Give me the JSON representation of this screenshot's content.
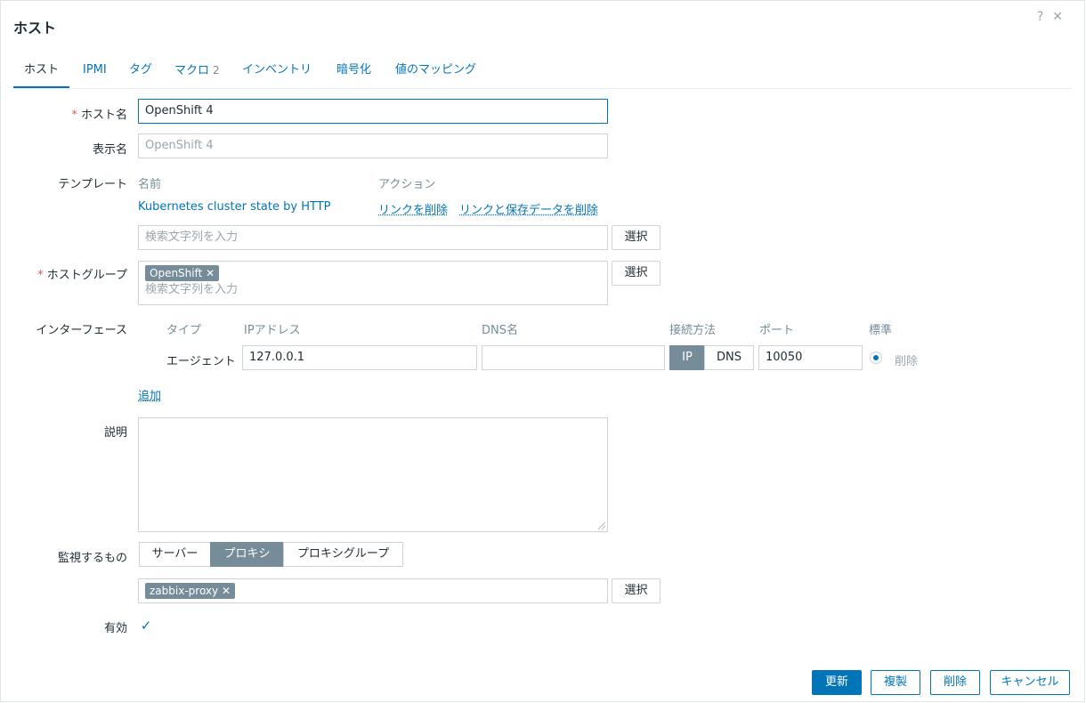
{
  "dialog": {
    "title": "ホスト",
    "help_icon": "?",
    "close_icon": "✕"
  },
  "tabs": [
    {
      "label": "ホスト"
    },
    {
      "label": "IPMI"
    },
    {
      "label": "タグ"
    },
    {
      "label": "マクロ",
      "count": "2"
    },
    {
      "label": "インベントリ"
    },
    {
      "label": "暗号化"
    },
    {
      "label": "値のマッピング"
    }
  ],
  "form": {
    "hostname": {
      "label": "ホスト名",
      "required_mark": "*",
      "value": "OpenShift 4"
    },
    "visible_name": {
      "label": "表示名",
      "placeholder": "OpenShift 4"
    },
    "templates": {
      "label": "テンプレート",
      "col_name": "名前",
      "col_action": "アクション",
      "linked": [
        {
          "name": "Kubernetes cluster state by HTTP",
          "unlink": "リンクを削除",
          "unlink_clear": "リンクと保存データを削除"
        }
      ],
      "search_placeholder": "検索文字列を入力",
      "select_button": "選択"
    },
    "host_groups": {
      "label": "ホストグループ",
      "required_mark": "*",
      "chips": [
        {
          "name": "OpenShift",
          "remove": "✕"
        }
      ],
      "search_placeholder": "検索文字列を入力",
      "select_button": "選択"
    },
    "interfaces": {
      "label": "インターフェース",
      "headers": {
        "type": "タイプ",
        "ip": "IPアドレス",
        "dns": "DNS名",
        "connect": "接続方法",
        "port": "ポート",
        "default": "標準"
      },
      "rows": [
        {
          "type": "エージェント",
          "ip": "127.0.0.1",
          "dns": "",
          "connect_ip": "IP",
          "connect_dns": "DNS",
          "connect_selected": "IP",
          "port": "10050",
          "remove": "削除"
        }
      ],
      "add_link": "追加"
    },
    "description": {
      "label": "説明",
      "value": ""
    },
    "monitored_by": {
      "label": "監視するもの",
      "options": [
        "サーバー",
        "プロキシ",
        "プロキシグループ"
      ],
      "selected": "プロキシ",
      "chips": [
        {
          "name": "zabbix-proxy",
          "remove": "✕"
        }
      ],
      "select_button": "選択"
    },
    "enabled": {
      "label": "有効",
      "checked": true,
      "check_icon": "✓"
    }
  },
  "footer": {
    "update": "更新",
    "clone": "複製",
    "delete": "削除",
    "cancel": "キャンセル"
  },
  "colors": {
    "accent": "#0275b8",
    "muted_bg": "#768d99",
    "required": "#e45959"
  }
}
